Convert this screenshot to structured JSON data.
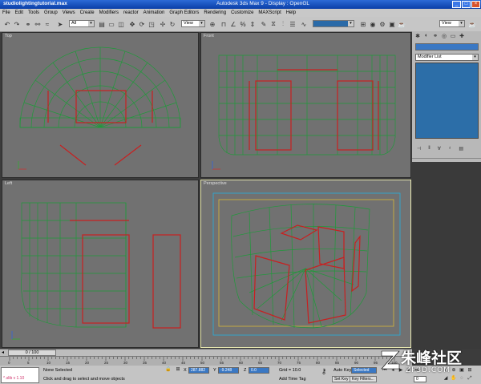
{
  "window": {
    "file_title": "studiolightingtutorial.max",
    "app_title": "Autodesk 3ds Max 9",
    "display": "- Display : OpenGL"
  },
  "menu": [
    "File",
    "Edit",
    "Tools",
    "Group",
    "Views",
    "Create",
    "Modifiers",
    "reactor",
    "Animation",
    "Graph Editors",
    "Rendering",
    "Customize",
    "MAXScript",
    "Help"
  ],
  "toolbar": {
    "selection_filter": "All",
    "ref_coord": "View",
    "named_selection": "",
    "render_view": "View"
  },
  "viewports": {
    "top": "Top",
    "front": "Front",
    "left": "Left",
    "perspective": "Perspective"
  },
  "command_panel": {
    "modifier_list": "Modifier List"
  },
  "timeline": {
    "frame": "0 / 100",
    "ticks": [
      "0",
      "5",
      "10",
      "15",
      "20",
      "25",
      "30",
      "35",
      "40",
      "45",
      "50",
      "55",
      "60",
      "65",
      "70",
      "75",
      "80",
      "85",
      "90",
      "95",
      "100"
    ]
  },
  "status": {
    "maxscript_label": "^.slib v 1.10",
    "selection": "None Selected",
    "prompt": "Click and drag to select and move objects",
    "x_label": "X",
    "x_value": "287.882",
    "y_label": "Y",
    "y_value": "-9.248",
    "z_label": "Z",
    "z_value": "0.0",
    "grid": "Grid = 10.0",
    "add_time_tag": "Add Time Tag",
    "auto_key": "Auto Key",
    "selected": "Selected",
    "set_key": "Set Key",
    "key_filters": "Key Filters...",
    "frame_field": "0"
  },
  "watermark": {
    "name": "朱峰社区",
    "site": "ZF3D.COM"
  },
  "colors": {
    "wire_green": "#1f9a3a",
    "light_red": "#c82020",
    "viewport_bg": "#717171",
    "selection_blue": "#3a78c4"
  }
}
